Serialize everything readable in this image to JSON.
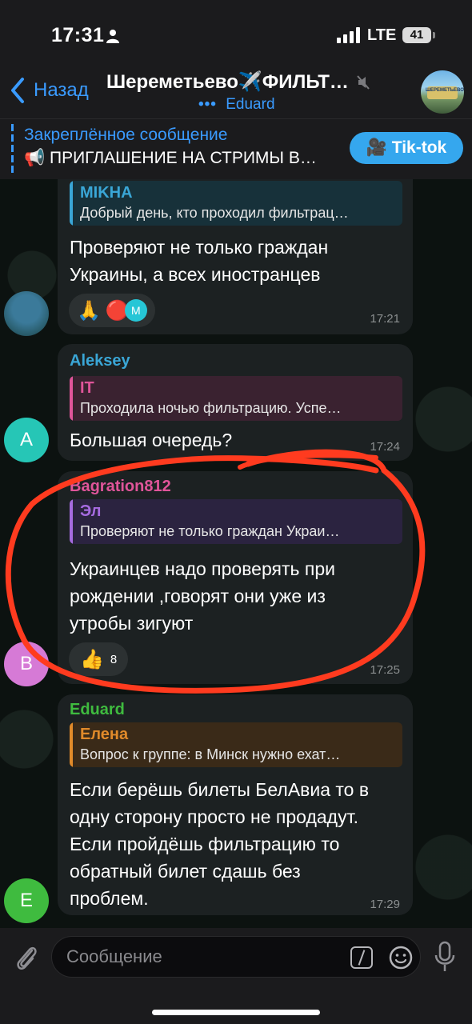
{
  "status": {
    "time": "17:31",
    "network": "LTE",
    "battery": "41"
  },
  "header": {
    "back_label": "Назад",
    "title_prefix": "Шереметьево",
    "title_emoji": "✈️",
    "title_suffix": "ФИЛЬТ…",
    "subtitle_dots": "•••",
    "subtitle": "Eduard",
    "avatar_sign": "ШЕРЕМЕТЬЕВО"
  },
  "pinned": {
    "title": "Закреплённое сообщение",
    "text": "📢 ПРИГЛАШЕНИЕ НА СТРИМЫ В…",
    "button_label": "🎥 Tik-tok"
  },
  "messages": [
    {
      "reply": {
        "name": "MIKHA",
        "text": "Добрый день, кто проходил фильтрац…",
        "color": "#3aa6d6"
      },
      "text_lines": [
        "Проверяют не только граждан",
        "Украины, а всех иностранцев"
      ],
      "reactions": [
        "🙏",
        "🔴"
      ],
      "reaction_avatar_letter": "М",
      "time": "17:21"
    },
    {
      "sender": "Aleksey",
      "sender_color": "#3aa6d6",
      "reply": {
        "name": "IT",
        "text": "Проходила ночью фильтрацию. Успе…",
        "color": "#e0559a"
      },
      "text_lines": [
        "Большая очередь?"
      ],
      "time": "17:24",
      "avatar_letter": "A",
      "avatar_color": "#26c6b6"
    },
    {
      "sender": "Bagration812",
      "sender_color": "#e0559a",
      "reply": {
        "name": "Эл",
        "text": "Проверяют не только граждан Украи…",
        "color": "#a66be0"
      },
      "text_lines": [
        "Украинцев надо проверять при",
        "рождении ,говорят они уже из",
        "утробы зигуют"
      ],
      "reaction": "👍",
      "reaction_count": "8",
      "time": "17:25",
      "avatar_letter": "B",
      "avatar_color": "#d67ad6"
    },
    {
      "sender": "Eduard",
      "sender_color": "#3fbb3f",
      "reply": {
        "name": "Елена",
        "text": "Вопрос к группе: в Минск нужно ехат…",
        "color": "#e08a2a"
      },
      "text_lines": [
        "Если берёшь билеты БелАвиа то в",
        "одну сторону просто не продадут.",
        "Если пройдёшь фильтрацию то",
        "обратный билет сдашь без",
        "проблем."
      ],
      "time": "17:29",
      "avatar_letter": "E",
      "avatar_color": "#3fbb3f"
    }
  ],
  "input": {
    "placeholder": "Сообщение"
  },
  "colors": {
    "accent": "#3a9bff",
    "annotation": "#ff3b1f"
  }
}
